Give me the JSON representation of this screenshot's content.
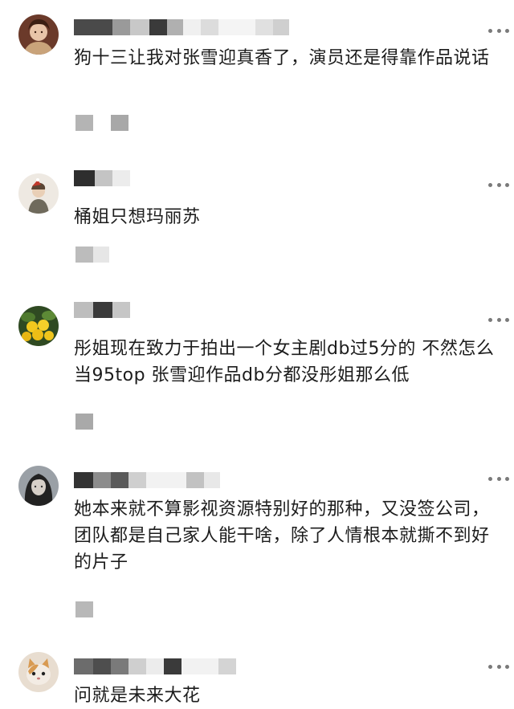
{
  "comments": [
    {
      "text": "狗十三让我对张雪迎真香了，演员还是得靠作品说话",
      "avatar_icon": "avatar-portrait-icon",
      "more_icon": "more-options-icon"
    },
    {
      "text": "桶姐只想玛丽苏",
      "avatar_icon": "avatar-illustration-icon",
      "more_icon": "more-options-icon"
    },
    {
      "text": "彤姐现在致力于拍出一个女主剧db过5分的  不然怎么当95top 张雪迎作品db分都没彤姐那么低",
      "avatar_icon": "avatar-fruit-icon",
      "more_icon": "more-options-icon"
    },
    {
      "text": "她本来就不算影视资源特别好的那种，又没签公司，团队都是自己家人能干啥，除了人情根本就撕不到好的片子",
      "avatar_icon": "avatar-girl-icon",
      "more_icon": "more-options-icon"
    },
    {
      "text": "问就是未来大花",
      "avatar_icon": "avatar-cat-icon",
      "more_icon": "more-options-icon"
    }
  ],
  "colors": {
    "text": "#1c1c1c",
    "dots": "#7a7a7a",
    "background": "#ffffff"
  }
}
